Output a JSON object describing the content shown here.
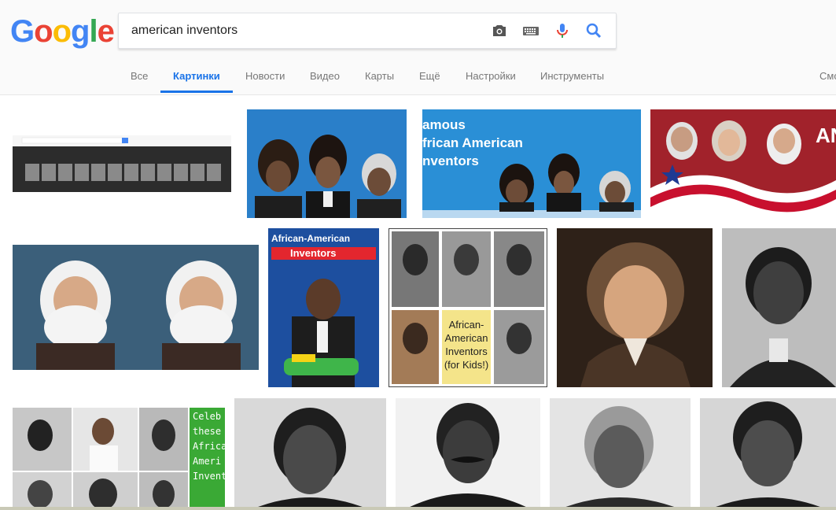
{
  "header": {
    "logo": "Google",
    "search": {
      "value": "american inventors"
    }
  },
  "tabs": {
    "all": "Все",
    "images": "Картинки",
    "news": "Новости",
    "video": "Видео",
    "maps": "Карты",
    "more": "Ещё",
    "settings": "Настройки",
    "tools": "Инструменты",
    "safe": "Смо"
  },
  "results": {
    "r1_3_text": "amous\nfrican American\nnventors",
    "r1_4_text": "AN",
    "r2_3_title1": "African-American",
    "r2_3_title2": "Inventors",
    "r2_4_text": "African-\nAmerican\nInventors\n(for Kids!)",
    "r3_1_text": "Celeb\nthese\nAfrica\nAmeri\nInvent"
  },
  "colors": {
    "accent": "#1a73e8",
    "result_blue": "#2a7fc9"
  }
}
